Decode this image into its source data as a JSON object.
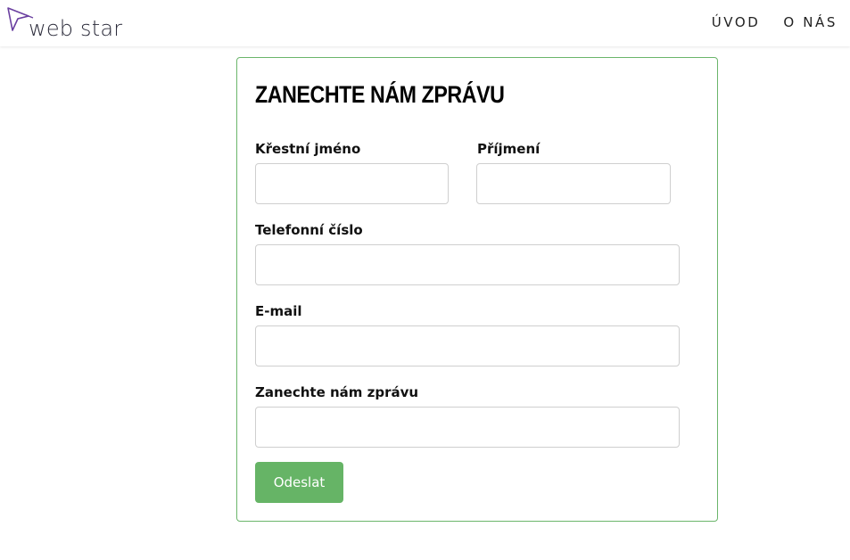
{
  "header": {
    "logo_text": "web star",
    "nav": [
      {
        "label": "ÚVOD"
      },
      {
        "label": "O NÁS"
      }
    ]
  },
  "form": {
    "title": "ZANECHTE NÁM ZPRÁVU",
    "first_name": {
      "label": "Křestní jméno",
      "value": "",
      "placeholder": ""
    },
    "last_name": {
      "label": "Příjmení",
      "value": "",
      "placeholder": ""
    },
    "phone": {
      "label": "Telefonní číslo",
      "value": "",
      "placeholder": ""
    },
    "email": {
      "label": "E-mail",
      "value": "",
      "placeholder": ""
    },
    "message": {
      "label": "Zanechte nám zprávu",
      "value": "",
      "placeholder": ""
    },
    "submit_label": "Odeslat"
  },
  "colors": {
    "accent_green": "#66b466",
    "card_border": "#6bb56b",
    "logo_purple": "#6a3fa0"
  },
  "icons": {
    "logo": "paper-plane-star-icon"
  }
}
